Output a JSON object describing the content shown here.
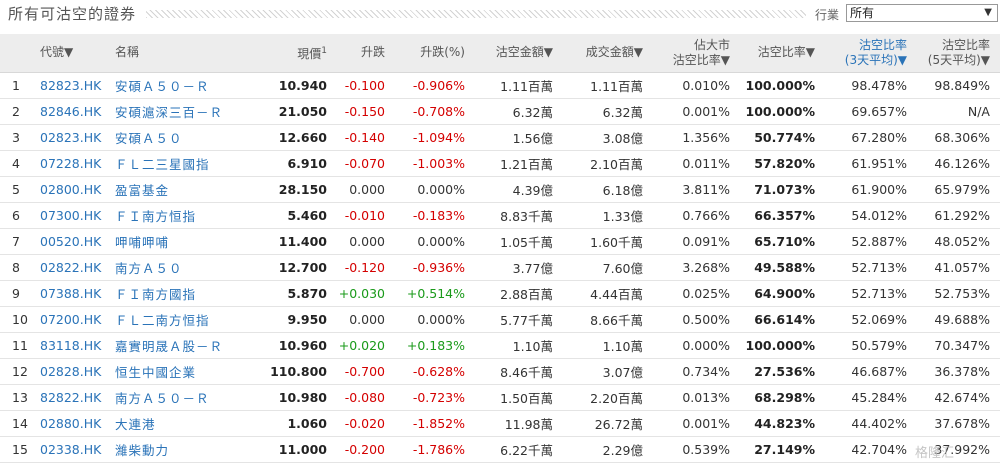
{
  "page": {
    "title": "所有可沽空的證券",
    "filter_label": "行業",
    "filter_value": "所有",
    "watermark": "格隆汇"
  },
  "colors": {
    "link": "#2a73b8",
    "negative": "#d40000",
    "positive": "#1a9a1a",
    "header_bg": "#ededed"
  },
  "table": {
    "headers": [
      {
        "text": "",
        "sub": ""
      },
      {
        "text": "代號▼",
        "sub": ""
      },
      {
        "text": "名稱",
        "sub": ""
      },
      {
        "text": "現價",
        "sup": "1",
        "sub": ""
      },
      {
        "text": "升跌",
        "sub": ""
      },
      {
        "text": "升跌(%)",
        "sub": ""
      },
      {
        "text": "沽空金額▼",
        "sub": ""
      },
      {
        "text": "成交金額▼",
        "sub": ""
      },
      {
        "text": "佔大市",
        "sub": "沽空比率▼"
      },
      {
        "text": "沽空比率▼",
        "sub": ""
      },
      {
        "text": "沽空比率",
        "sub": "(3天平均)▼"
      },
      {
        "text": "沽空比率",
        "sub": "(5天平均)▼"
      }
    ],
    "rows": [
      {
        "idx": "1",
        "code": "82823.HK",
        "name": "安碩Ａ５０－Ｒ",
        "price": "10.940",
        "change": "-0.100",
        "pct": "-0.906%",
        "dir": "neg",
        "short_amt": "1.11百萬",
        "turnover": "1.11百萬",
        "mkt_ratio": "0.010%",
        "ratio": "100.000%",
        "avg3": "98.478%",
        "avg5": "98.849%"
      },
      {
        "idx": "2",
        "code": "82846.HK",
        "name": "安碩滬深三百－Ｒ",
        "price": "21.050",
        "change": "-0.150",
        "pct": "-0.708%",
        "dir": "neg",
        "short_amt": "6.32萬",
        "turnover": "6.32萬",
        "mkt_ratio": "0.001%",
        "ratio": "100.000%",
        "avg3": "69.657%",
        "avg5": "N/A"
      },
      {
        "idx": "3",
        "code": "02823.HK",
        "name": "安碩Ａ５０",
        "price": "12.660",
        "change": "-0.140",
        "pct": "-1.094%",
        "dir": "neg",
        "short_amt": "1.56億",
        "turnover": "3.08億",
        "mkt_ratio": "1.356%",
        "ratio": "50.774%",
        "avg3": "67.280%",
        "avg5": "68.306%"
      },
      {
        "idx": "4",
        "code": "07228.HK",
        "name": "ＦＬ二三星國指",
        "price": "6.910",
        "change": "-0.070",
        "pct": "-1.003%",
        "dir": "neg",
        "short_amt": "1.21百萬",
        "turnover": "2.10百萬",
        "mkt_ratio": "0.011%",
        "ratio": "57.820%",
        "avg3": "61.951%",
        "avg5": "46.126%"
      },
      {
        "idx": "5",
        "code": "02800.HK",
        "name": "盈富基金",
        "price": "28.150",
        "change": "0.000",
        "pct": "0.000%",
        "dir": "flat",
        "short_amt": "4.39億",
        "turnover": "6.18億",
        "mkt_ratio": "3.811%",
        "ratio": "71.073%",
        "avg3": "61.900%",
        "avg5": "65.979%"
      },
      {
        "idx": "6",
        "code": "07300.HK",
        "name": "ＦＩ南方恒指",
        "price": "5.460",
        "change": "-0.010",
        "pct": "-0.183%",
        "dir": "neg",
        "short_amt": "8.83千萬",
        "turnover": "1.33億",
        "mkt_ratio": "0.766%",
        "ratio": "66.357%",
        "avg3": "54.012%",
        "avg5": "61.292%"
      },
      {
        "idx": "7",
        "code": "00520.HK",
        "name": "呷哺呷哺",
        "price": "11.400",
        "change": "0.000",
        "pct": "0.000%",
        "dir": "flat",
        "short_amt": "1.05千萬",
        "turnover": "1.60千萬",
        "mkt_ratio": "0.091%",
        "ratio": "65.710%",
        "avg3": "52.887%",
        "avg5": "48.052%"
      },
      {
        "idx": "8",
        "code": "02822.HK",
        "name": "南方Ａ５０",
        "price": "12.700",
        "change": "-0.120",
        "pct": "-0.936%",
        "dir": "neg",
        "short_amt": "3.77億",
        "turnover": "7.60億",
        "mkt_ratio": "3.268%",
        "ratio": "49.588%",
        "avg3": "52.713%",
        "avg5": "41.057%"
      },
      {
        "idx": "9",
        "code": "07388.HK",
        "name": "ＦＩ南方國指",
        "price": "5.870",
        "change": "+0.030",
        "pct": "+0.514%",
        "dir": "pos",
        "short_amt": "2.88百萬",
        "turnover": "4.44百萬",
        "mkt_ratio": "0.025%",
        "ratio": "64.900%",
        "avg3": "52.713%",
        "avg5": "52.753%"
      },
      {
        "idx": "10",
        "code": "07200.HK",
        "name": "ＦＬ二南方恒指",
        "price": "9.950",
        "change": "0.000",
        "pct": "0.000%",
        "dir": "flat",
        "short_amt": "5.77千萬",
        "turnover": "8.66千萬",
        "mkt_ratio": "0.500%",
        "ratio": "66.614%",
        "avg3": "52.069%",
        "avg5": "49.688%"
      },
      {
        "idx": "11",
        "code": "83118.HK",
        "name": "嘉實明晟Ａ股－Ｒ",
        "price": "10.960",
        "change": "+0.020",
        "pct": "+0.183%",
        "dir": "pos",
        "short_amt": "1.10萬",
        "turnover": "1.10萬",
        "mkt_ratio": "0.000%",
        "ratio": "100.000%",
        "avg3": "50.579%",
        "avg5": "70.347%"
      },
      {
        "idx": "12",
        "code": "02828.HK",
        "name": "恒生中國企業",
        "price": "110.800",
        "change": "-0.700",
        "pct": "-0.628%",
        "dir": "neg",
        "short_amt": "8.46千萬",
        "turnover": "3.07億",
        "mkt_ratio": "0.734%",
        "ratio": "27.536%",
        "avg3": "46.687%",
        "avg5": "36.378%"
      },
      {
        "idx": "13",
        "code": "82822.HK",
        "name": "南方Ａ５０－Ｒ",
        "price": "10.980",
        "change": "-0.080",
        "pct": "-0.723%",
        "dir": "neg",
        "short_amt": "1.50百萬",
        "turnover": "2.20百萬",
        "mkt_ratio": "0.013%",
        "ratio": "68.298%",
        "avg3": "45.284%",
        "avg5": "42.674%"
      },
      {
        "idx": "14",
        "code": "02880.HK",
        "name": "大連港",
        "price": "1.060",
        "change": "-0.020",
        "pct": "-1.852%",
        "dir": "neg",
        "short_amt": "11.98萬",
        "turnover": "26.72萬",
        "mkt_ratio": "0.001%",
        "ratio": "44.823%",
        "avg3": "44.402%",
        "avg5": "37.678%"
      },
      {
        "idx": "15",
        "code": "02338.HK",
        "name": "濰柴動力",
        "price": "11.000",
        "change": "-0.200",
        "pct": "-1.786%",
        "dir": "neg",
        "short_amt": "6.22千萬",
        "turnover": "2.29億",
        "mkt_ratio": "0.539%",
        "ratio": "27.149%",
        "avg3": "42.704%",
        "avg5": "37.992%"
      }
    ]
  }
}
